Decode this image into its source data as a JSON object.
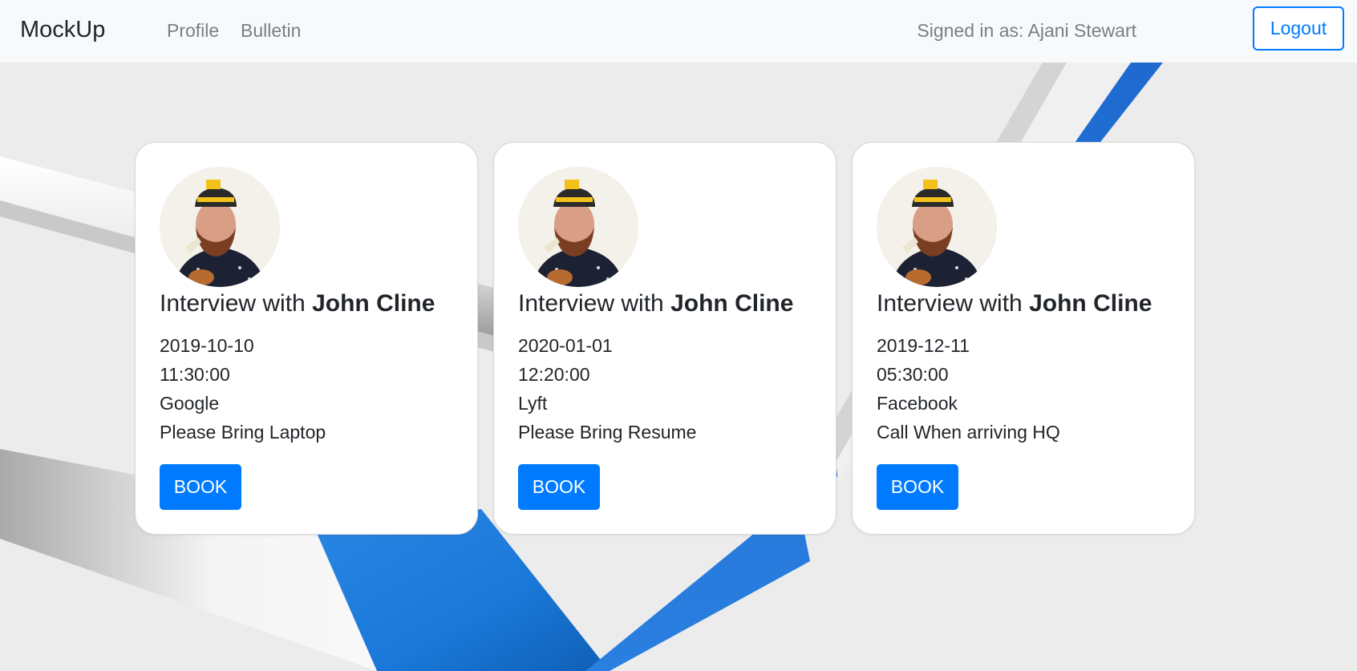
{
  "navbar": {
    "brand": "MockUp",
    "links": [
      {
        "label": "Profile"
      },
      {
        "label": "Bulletin"
      }
    ],
    "signed_in_text": "Signed in as: Ajani Stewart",
    "logout_label": "Logout"
  },
  "colors": {
    "primary": "#007bff",
    "navbar_bg": "#f8f9fa",
    "page_bg": "#ececec",
    "accent_blue": "#1f75d6"
  },
  "cards": [
    {
      "avatar_icon": "person-with-pipe-avatar",
      "title_prefix": "Interview with ",
      "title_name": "John Cline",
      "date": "2019-10-10",
      "time": "11:30:00",
      "company": "Google",
      "note": "Please Bring Laptop",
      "button_label": "BOOK"
    },
    {
      "avatar_icon": "person-with-pipe-avatar",
      "title_prefix": "Interview with ",
      "title_name": "John Cline",
      "date": "2020-01-01",
      "time": "12:20:00",
      "company": "Lyft",
      "note": "Please Bring Resume",
      "button_label": "BOOK"
    },
    {
      "avatar_icon": "person-with-pipe-avatar",
      "title_prefix": "Interview with ",
      "title_name": "John Cline",
      "date": "2019-12-11",
      "time": "05:30:00",
      "company": "Facebook",
      "note": "Call When arriving HQ",
      "button_label": "BOOK"
    }
  ]
}
